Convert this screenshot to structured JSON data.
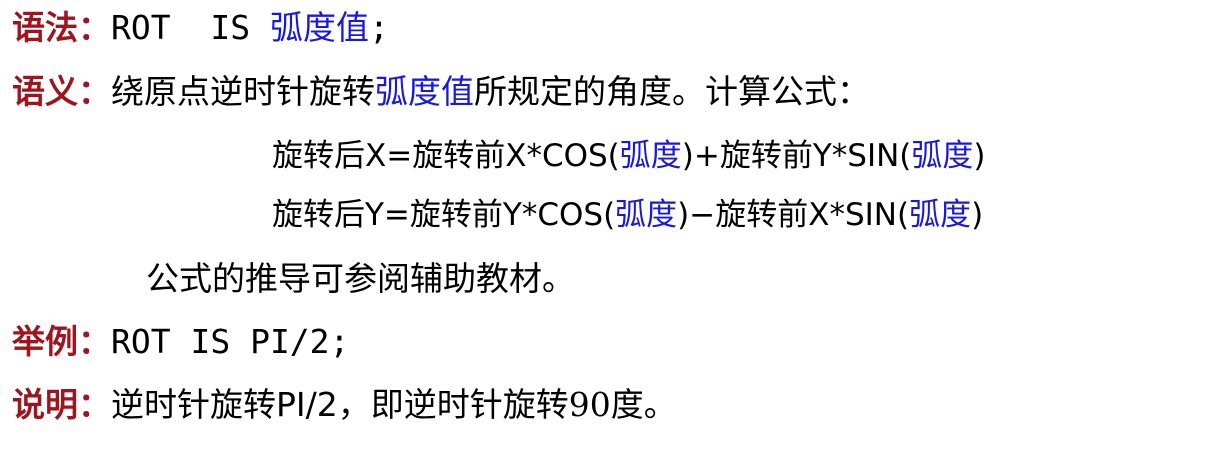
{
  "colors": {
    "label": "#a0141e",
    "text": "#000000",
    "highlight": "#1a1ad6"
  },
  "syntax": {
    "label": "语法：",
    "code_a": "ROT  IS ",
    "param": "弧度值",
    "code_b": ";"
  },
  "semantics": {
    "label": "语义：",
    "text_a": "绕原点逆时针旋转",
    "param": "弧度值",
    "text_b": "所规定的角度。计算公式："
  },
  "formula1": {
    "a": "旋转后X=旋转前X*COS(",
    "b": "弧度",
    "c": ")+旋转前Y*SIN(",
    "d": "弧度",
    "e": ")"
  },
  "formula2": {
    "a": "旋转后Y=旋转前Y*COS(",
    "b": "弧度",
    "c": ")−旋转前X*SIN(",
    "d": "弧度",
    "e": ")"
  },
  "note": "公式的推导可参阅辅助教材。",
  "example": {
    "label": "举例：",
    "code": "ROT IS PI/2;"
  },
  "explanation": {
    "label": "说明：",
    "text_a": "逆时针旋转PI/2，即逆时针旋转",
    "number": "90",
    "text_b": "度。"
  }
}
